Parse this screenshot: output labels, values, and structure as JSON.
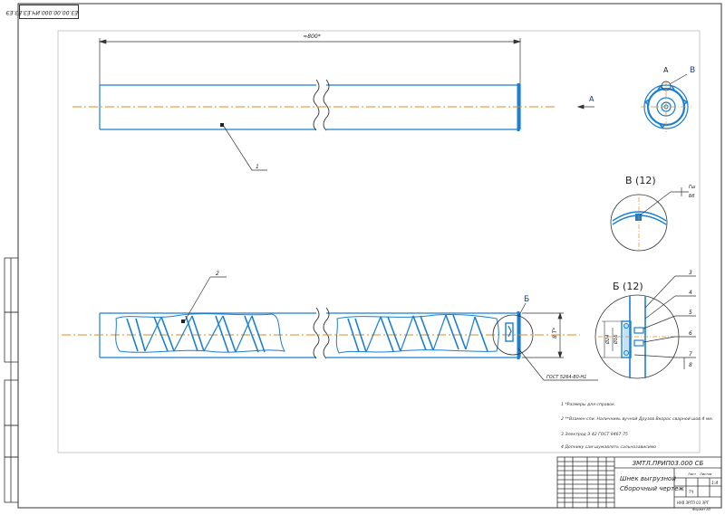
{
  "sheet": {
    "top_stamp": "ЕЗ.00.00.000.ИЧ.ЕЗ.ЕЗ.ЕЭ",
    "section_a": "А",
    "section_a_arrow": "А",
    "section_v": "В",
    "section_b": "Б",
    "view_v_title": "В (12)",
    "view_b_title": "Б (12)"
  },
  "dimensions": {
    "overall_length": "≈800*",
    "diameter_right": "8 Т*",
    "inner_dim_1": "Ø24",
    "inner_dim_2": "Ø16",
    "view_v_mark_top": "Гш",
    "view_v_mark_bottom": "Бб"
  },
  "leaders": {
    "pos1": "1",
    "pos2": "2",
    "b3": "3",
    "b4": "4",
    "b5": "5",
    "b6": "6",
    "b7": "7",
    "b8": "8",
    "gost_weld": "ГОСТ 5264-80-Н1"
  },
  "notes": [
    "1 *Размеры для справок.",
    "2 **Взамен спи. Наличниеь вучной Друзов Вкорос сварной шов 4 мм.",
    "3 Электрод Э 42 ГОСТ 9467-75",
    "4 Допнику сам шумавлять сальнозависимо"
  ],
  "title_block": {
    "doc_code": "ЗМТЛ.ПРИП03.000 СБ",
    "name_line1": "Шнек выгрузной",
    "name_line2": "Сборочный чертеж",
    "sheet_label": "Лист",
    "sheet_count": "Листов",
    "scale": "1:4",
    "org_line": "ТЧ",
    "org_code": "НУВ ЗРТП 03 ЗРТ",
    "bottom_left": "",
    "bottom_right": "Формат А3"
  },
  "colors": {
    "drawing": "#1a7fd4",
    "frame": "#333333",
    "center_line": "#e08a1e",
    "text": "#222222"
  }
}
